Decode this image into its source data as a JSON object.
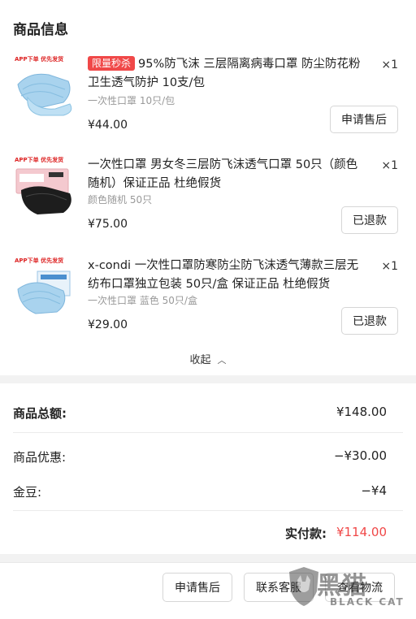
{
  "section_title": "商品信息",
  "thumb_tag": "APP下单 优先发货",
  "products": [
    {
      "badge": "限量秒杀",
      "title": "95%防飞沫 三层隔离病毒口罩 防尘防花粉卫生透气防护 10支/包",
      "spec": "一次性口罩 10只/包",
      "price": "¥44.00",
      "qty": "×1",
      "action": "申请售后"
    },
    {
      "badge": "",
      "title": "一次性口罩 男女冬三层防飞沫透气口罩 50只（颜色随机）保证正品 杜绝假货",
      "spec": "颜色随机 50只",
      "price": "¥75.00",
      "qty": "×1",
      "action": "已退款"
    },
    {
      "badge": "",
      "title": "x-condi 一次性口罩防寒防尘防飞沫透气薄款三层无纺布口罩独立包装 50只/盒 保证正品 杜绝假货",
      "spec": "一次性口罩 蓝色 50只/盒",
      "price": "¥29.00",
      "qty": "×1",
      "action": "已退款"
    }
  ],
  "collapse_label": "收起",
  "summary": {
    "goods_total_label": "商品总额:",
    "goods_total_value": "¥148.00",
    "discount_label": "商品优惠:",
    "discount_value": "−¥30.00",
    "jingdou_label": "金豆:",
    "jingdou_value": "−¥4",
    "paid_label": "实付款:",
    "paid_value": "¥114.00"
  },
  "footer_buttons": [
    "申请售后",
    "联系客服",
    "查看物流"
  ],
  "watermark": {
    "text": "黑猫",
    "sub": "BLACK CAT"
  },
  "colors": {
    "accent_red": "#f04848",
    "mask_blue": "#a9d3ee",
    "mask_black": "#1d1d1d",
    "mask_pink": "#f4c9cf"
  },
  "icons": {
    "collapse": "chevron-up-icon"
  }
}
